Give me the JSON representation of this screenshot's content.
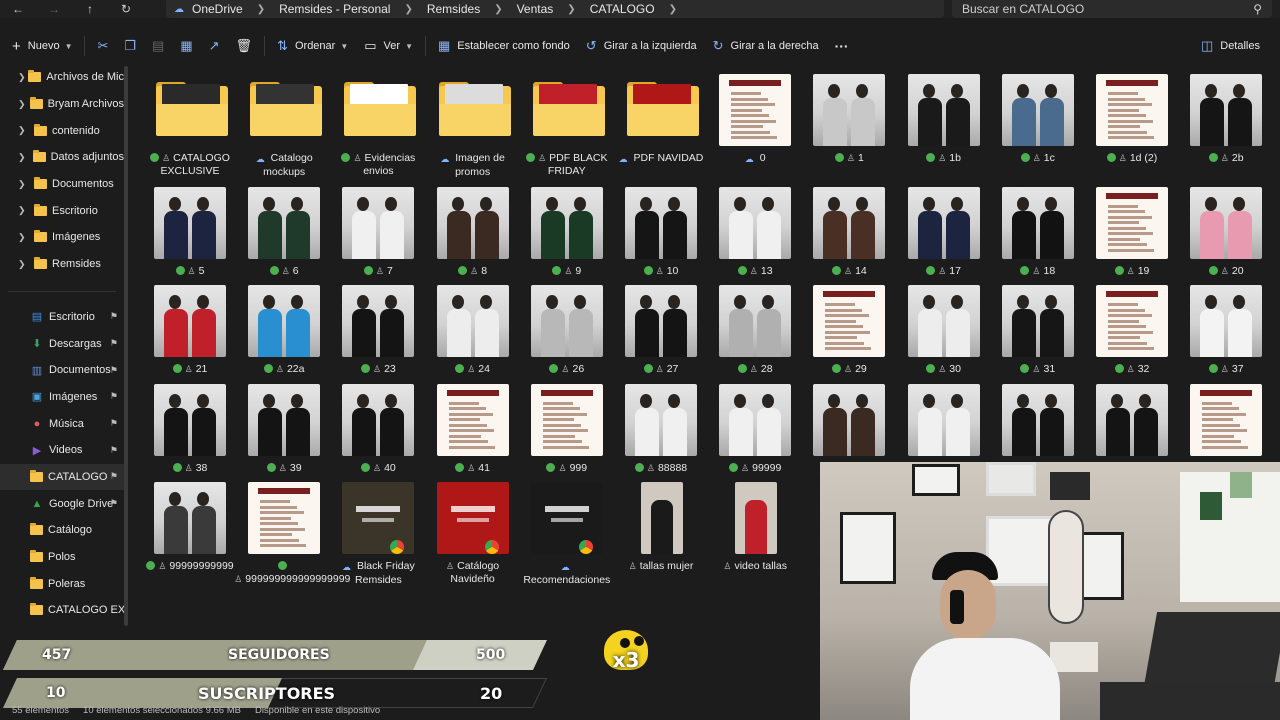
{
  "breadcrumb": [
    "OneDrive",
    "Remsides - Personal",
    "Remsides",
    "Ventas",
    "CATALOGO"
  ],
  "search": {
    "placeholder": "Buscar en CATALOGO"
  },
  "toolbar": {
    "nuevo": "Nuevo",
    "ordenar": "Ordenar",
    "ver": "Ver",
    "establecer": "Establecer como fondo",
    "girar_izq": "Girar a la izquierda",
    "girar_der": "Girar a la derecha",
    "more": "···",
    "detalles": "Detalles"
  },
  "sidebar": {
    "tree": [
      "Archivos de Mic",
      "Bryam Archivos",
      "contenido",
      "Datos adjuntos",
      "Documentos",
      "Escritorio",
      "Imágenes",
      "Remsides"
    ],
    "quick": [
      {
        "label": "Escritorio",
        "icon": "desktop-icon",
        "color": "#3b8fe6"
      },
      {
        "label": "Descargas",
        "icon": "download-icon",
        "color": "#3aa06a"
      },
      {
        "label": "Documentos",
        "icon": "document-icon",
        "color": "#5f8fd6"
      },
      {
        "label": "Imágenes",
        "icon": "image-icon",
        "color": "#4aa3df"
      },
      {
        "label": "Música",
        "icon": "music-icon",
        "color": "#e05b5b"
      },
      {
        "label": "Videos",
        "icon": "video-icon",
        "color": "#8a5cd6"
      },
      {
        "label": "CATALOGO",
        "icon": "folder-icon",
        "color": "#f5c24c"
      },
      {
        "label": "Google Drive",
        "icon": "google-drive-icon",
        "color": "#34a853"
      },
      {
        "label": "Catálogo",
        "icon": "folder-icon",
        "color": "#f5c24c"
      },
      {
        "label": "Polos",
        "icon": "folder-icon",
        "color": "#f5c24c"
      },
      {
        "label": "Poleras",
        "icon": "folder-icon",
        "color": "#f5c24c"
      },
      {
        "label": "CATALOGO EXCL",
        "icon": "folder-icon",
        "color": "#f5c24c"
      }
    ]
  },
  "files": [
    {
      "name": "CATALOGO EXCLUSIVE",
      "kind": "folder",
      "status": "ok",
      "paper": "#2a2a2a"
    },
    {
      "name": "Catalogo mockups",
      "kind": "folder",
      "status": "cloud",
      "paper": "#333333"
    },
    {
      "name": "Evidencias envios",
      "kind": "folder",
      "status": "ok",
      "paper": "#ffffff"
    },
    {
      "name": "Imagen de promos",
      "kind": "folder",
      "status": "cloud",
      "paper": "#dcdcdc"
    },
    {
      "name": "PDF BLACK FRIDAY",
      "kind": "folder",
      "status": "ok",
      "paper": "#c0202a"
    },
    {
      "name": "PDF NAVIDAD",
      "kind": "folder",
      "status": "cloud",
      "paper": "#b01818"
    },
    {
      "name": "0",
      "kind": "doc",
      "status": "cloud"
    },
    {
      "name": "1",
      "kind": "photo",
      "status": "ok",
      "shirt": "#c8c8c8"
    },
    {
      "name": "1b",
      "kind": "photo",
      "status": "ok",
      "shirt": "#1a1a1a"
    },
    {
      "name": "1c",
      "kind": "photo",
      "status": "ok",
      "shirt": "#4a6a8e"
    },
    {
      "name": "1d (2)",
      "kind": "doc",
      "status": "ok"
    },
    {
      "name": "2b",
      "kind": "photo",
      "status": "ok",
      "shirt": "#151515"
    },
    {
      "name": "5",
      "kind": "photo",
      "status": "ok",
      "shirt": "#1c2440"
    },
    {
      "name": "6",
      "kind": "photo",
      "status": "ok",
      "shirt": "#1f3a2a"
    },
    {
      "name": "7",
      "kind": "photo",
      "status": "ok",
      "shirt": "#f0f0f0"
    },
    {
      "name": "8",
      "kind": "photo",
      "status": "ok",
      "shirt": "#3a2a22"
    },
    {
      "name": "9",
      "kind": "photo",
      "status": "ok",
      "shirt": "#1b3a26"
    },
    {
      "name": "10",
      "kind": "photo",
      "status": "ok",
      "shirt": "#151515"
    },
    {
      "name": "13",
      "kind": "photo",
      "status": "ok",
      "shirt": "#f0f0f0"
    },
    {
      "name": "14",
      "kind": "photo",
      "status": "ok",
      "shirt": "#4a3024"
    },
    {
      "name": "17",
      "kind": "photo",
      "status": "ok",
      "shirt": "#1c2440"
    },
    {
      "name": "18",
      "kind": "photo",
      "status": "ok",
      "shirt": "#121212"
    },
    {
      "name": "19",
      "kind": "doc",
      "status": "ok"
    },
    {
      "name": "20",
      "kind": "photo",
      "status": "ok",
      "shirt": "#e89ab0"
    },
    {
      "name": "21",
      "kind": "photo",
      "status": "ok",
      "shirt": "#c0202a"
    },
    {
      "name": "22a",
      "kind": "photo",
      "status": "ok",
      "shirt": "#2a8fd0"
    },
    {
      "name": "23",
      "kind": "photo",
      "status": "ok",
      "shirt": "#141414"
    },
    {
      "name": "24",
      "kind": "photo",
      "status": "ok",
      "shirt": "#ededed"
    },
    {
      "name": "26",
      "kind": "photo",
      "status": "ok",
      "shirt": "#b8b8b8"
    },
    {
      "name": "27",
      "kind": "photo",
      "status": "ok",
      "shirt": "#141414"
    },
    {
      "name": "28",
      "kind": "photo",
      "status": "ok",
      "shirt": "#b0b0b0"
    },
    {
      "name": "29",
      "kind": "doc",
      "status": "ok"
    },
    {
      "name": "30",
      "kind": "photo",
      "status": "ok",
      "shirt": "#ededed"
    },
    {
      "name": "31",
      "kind": "photo",
      "status": "ok",
      "shirt": "#161616"
    },
    {
      "name": "32",
      "kind": "doc",
      "status": "ok"
    },
    {
      "name": "37",
      "kind": "photo",
      "status": "ok",
      "shirt": "#f3f3f3"
    },
    {
      "name": "38",
      "kind": "photo",
      "status": "ok",
      "shirt": "#141414"
    },
    {
      "name": "39",
      "kind": "photo",
      "status": "ok",
      "shirt": "#141414"
    },
    {
      "name": "40",
      "kind": "photo",
      "status": "ok",
      "shirt": "#141414"
    },
    {
      "name": "41",
      "kind": "doc",
      "status": "ok"
    },
    {
      "name": "999",
      "kind": "doc",
      "status": "ok"
    },
    {
      "name": "88888",
      "kind": "photo",
      "status": "ok",
      "shirt": "#f0f0f0"
    },
    {
      "name": "99999",
      "kind": "photo",
      "status": "ok",
      "shirt": "#f0f0f0"
    },
    {
      "name": "",
      "kind": "photo",
      "status": "none",
      "shirt": "#3a2a22"
    },
    {
      "name": "",
      "kind": "photo",
      "status": "none",
      "shirt": "#f0f0f0"
    },
    {
      "name": "",
      "kind": "photo",
      "status": "none",
      "shirt": "#141414"
    },
    {
      "name": "",
      "kind": "photo",
      "status": "none",
      "shirt": "#141414"
    },
    {
      "name": "",
      "kind": "doc",
      "status": "none"
    },
    {
      "name": "99999999999",
      "kind": "photo",
      "status": "ok",
      "shirt": "#3a3a3a"
    },
    {
      "name": "999999999999999999",
      "kind": "doc",
      "status": "ok"
    },
    {
      "name": "Black Friday Remsides",
      "kind": "poster",
      "status": "cloud",
      "poster": "#3b3428"
    },
    {
      "name": "Catálogo Navideño",
      "kind": "poster",
      "status": "user",
      "poster": "#b01818"
    },
    {
      "name": "Recomendaciones",
      "kind": "poster",
      "status": "cloud",
      "poster": "#1a1a1a"
    },
    {
      "name": "tallas mujer",
      "kind": "tall",
      "status": "user",
      "shirt": "#1a1a1a"
    },
    {
      "name": "video tallas",
      "kind": "tall",
      "status": "user",
      "shirt": "#c0202a"
    }
  ],
  "stats": {
    "seguidores_label": "SEGUIDORES",
    "seguidores_count": "457",
    "seguidores_goal": "500",
    "suscriptores_label": "SUSCRIPTORES",
    "suscriptores_count": "10",
    "suscriptores_goal": "20",
    "multiplier": "x3"
  },
  "status": {
    "items": "55 elementos",
    "selected": "10 elementos seleccionados 9.66 MB",
    "availability": "Disponible en este dispositivo"
  }
}
